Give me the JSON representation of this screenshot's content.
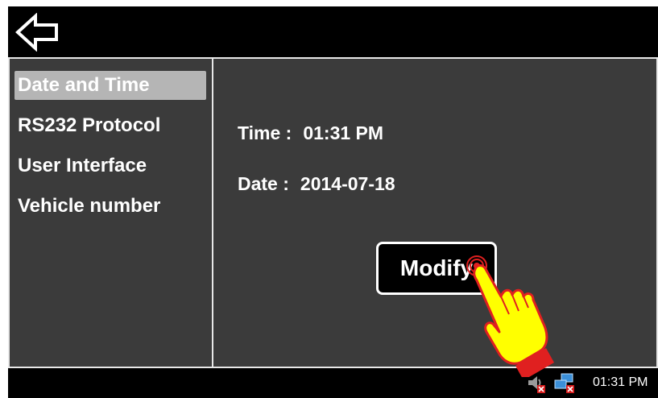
{
  "sidebar": {
    "items": [
      {
        "label": "Date and Time"
      },
      {
        "label": "RS232 Protocol"
      },
      {
        "label": "User Interface"
      },
      {
        "label": "Vehicle number"
      }
    ],
    "selected": "Date and Time"
  },
  "content": {
    "time_label": "Time :",
    "time_value": "01:31 PM",
    "date_label": "Date :",
    "date_value": "2014-07-18",
    "modify_label": "Modify"
  },
  "taskbar": {
    "clock": "01:31 PM",
    "icons": [
      "volume-muted-icon",
      "network-disconnected-icon"
    ]
  },
  "icons": {
    "back": "back-arrow-icon",
    "pointer": "tap-hand-icon"
  },
  "colors": {
    "panel_bg": "#3b3b3b",
    "selected_bg": "#b5b5b5",
    "hand_fill": "#ffff00",
    "hand_cuff": "#e02020"
  }
}
